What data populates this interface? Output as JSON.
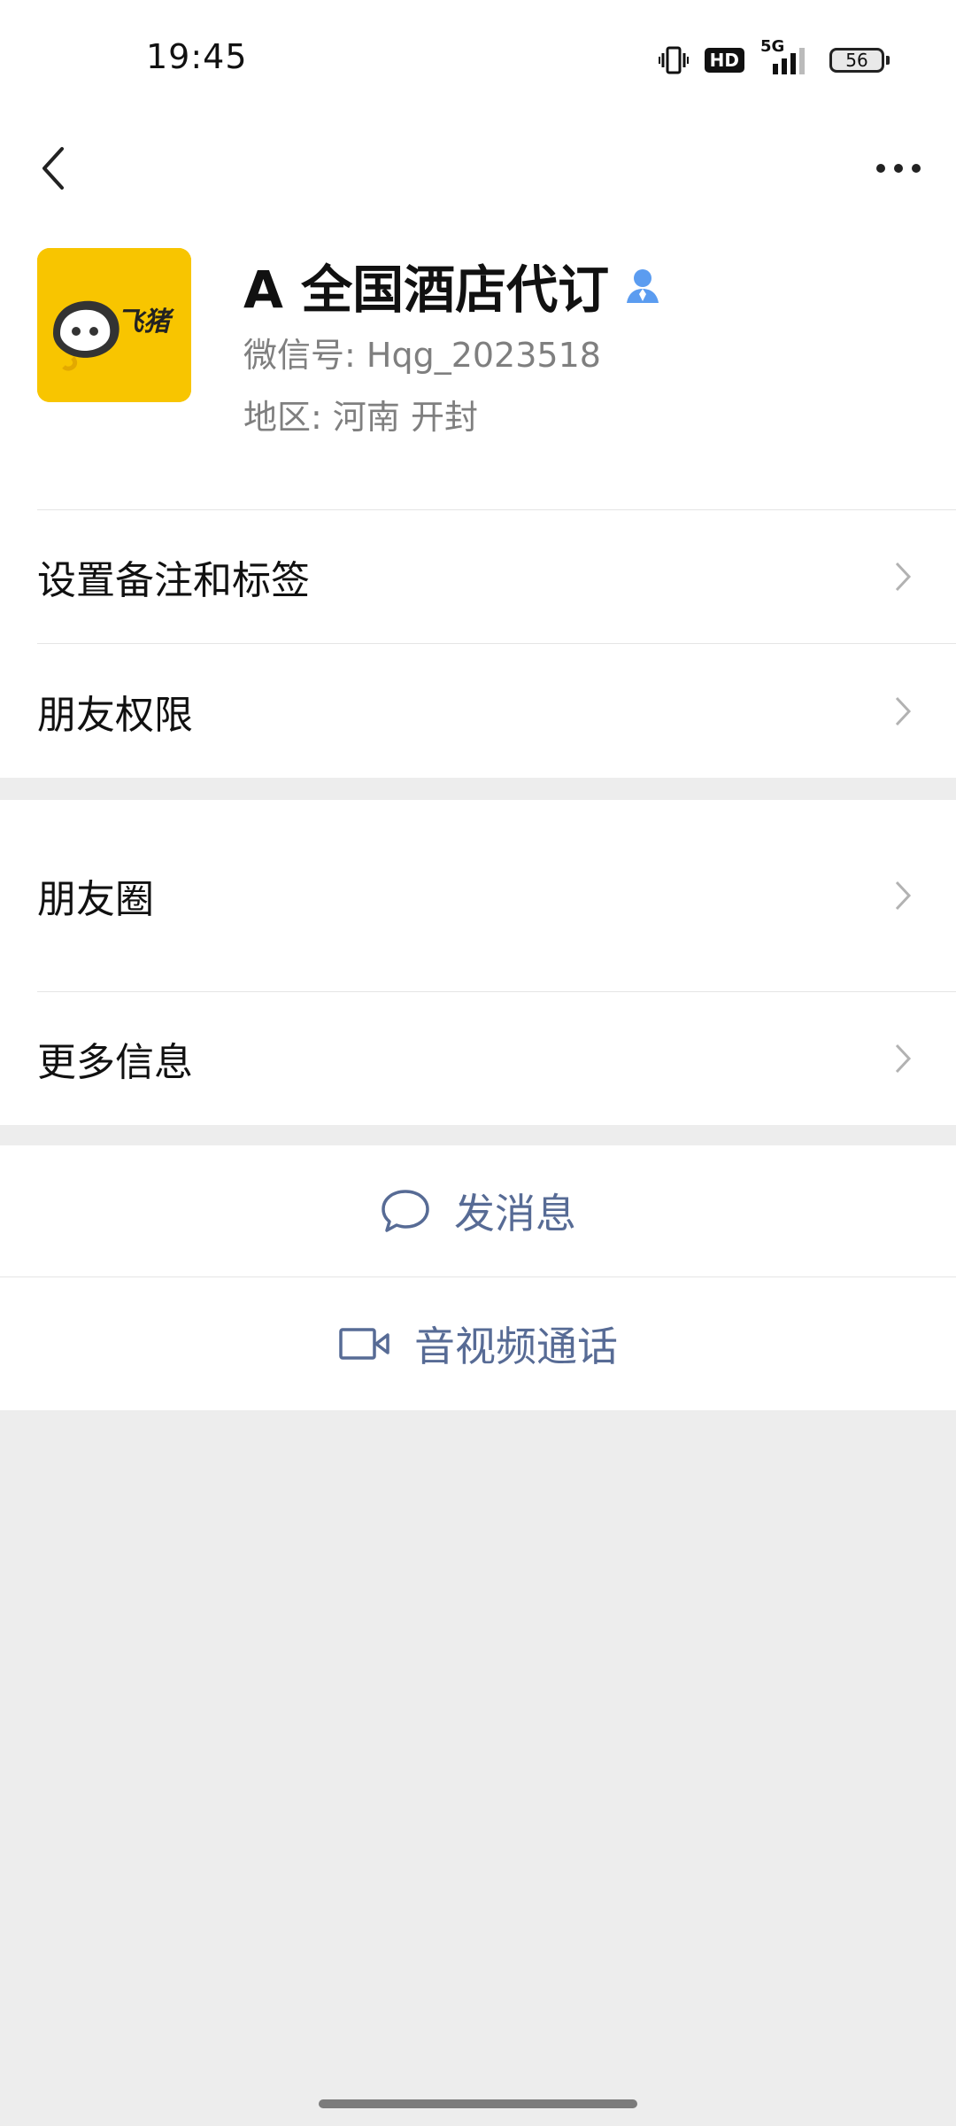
{
  "status_bar": {
    "time": "19:45",
    "hd": "HD",
    "network": "5G",
    "battery": "56"
  },
  "nav": {
    "back_icon": "chevron-left-icon",
    "more_icon": "more-dots-icon"
  },
  "profile": {
    "avatar_logo_text": "飞猪",
    "name": "A 全国酒店代订",
    "wechat_id": "微信号:  Hqg_2023518",
    "region": "地区:  河南  开封",
    "verified_icon": "person-icon",
    "colors": {
      "avatar_bg": "#f8c500",
      "verified": "#5b9cf0"
    }
  },
  "menu": {
    "remarks_tags": "设置备注和标签",
    "friend_permissions": "朋友权限",
    "moments": "朋友圈",
    "more_info": "更多信息"
  },
  "actions": {
    "send_message": "发消息",
    "call": "音视频通话",
    "accent_color": "#576b95"
  }
}
